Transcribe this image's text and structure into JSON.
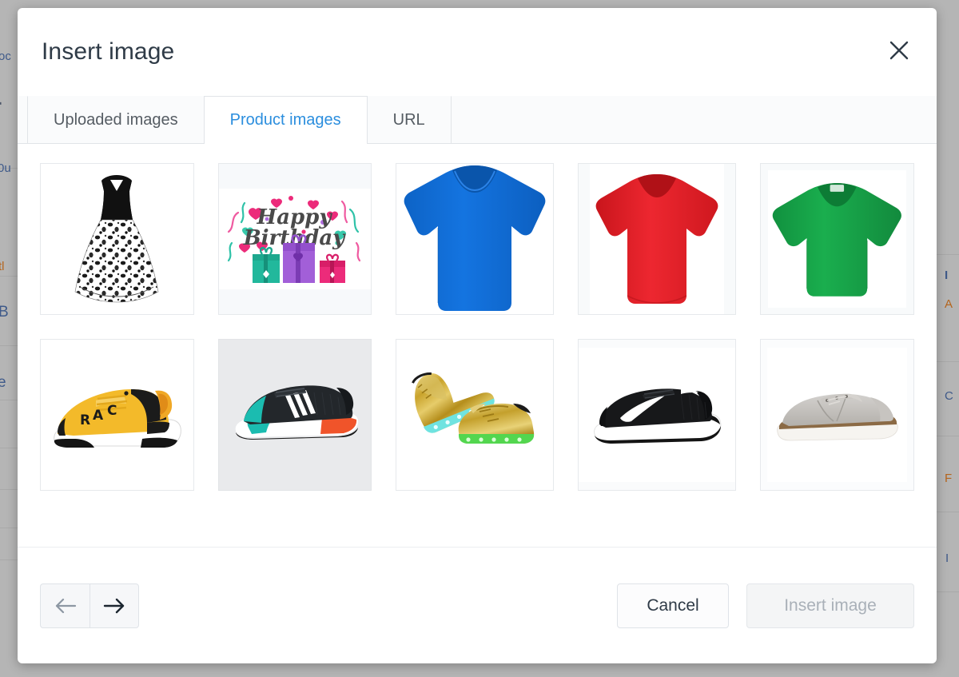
{
  "modal": {
    "title": "Insert image",
    "close_icon": "close-icon",
    "tabs": [
      {
        "label": "Uploaded images",
        "active": false
      },
      {
        "label": "Product images",
        "active": true
      },
      {
        "label": "URL",
        "active": false
      }
    ],
    "active_tab": "Product images",
    "accent_color": "#2b8ede"
  },
  "gallery": {
    "columns": 5,
    "items": [
      {
        "name": "black-white-floral-dress",
        "type": "dress",
        "background": "#ffffff"
      },
      {
        "name": "happy-birthday-card",
        "type": "greeting-card",
        "background": "#f7f9fb"
      },
      {
        "name": "blue-t-shirt",
        "type": "tshirt",
        "color": "#1070d6",
        "background": "#ffffff"
      },
      {
        "name": "red-t-shirt",
        "type": "tshirt",
        "color": "#e4232b",
        "background": "#f8fafb"
      },
      {
        "name": "green-t-shirt",
        "type": "tshirt",
        "color": "#17a84a",
        "background": "#f8fafb"
      },
      {
        "name": "yellow-sneaker",
        "type": "sneaker",
        "color": "#f2b728",
        "background": "#ffffff"
      },
      {
        "name": "black-running-shoe",
        "type": "runner",
        "color": "#222629",
        "background": "#e9eaec"
      },
      {
        "name": "gold-led-sneakers",
        "type": "led-sneakers",
        "color": "#d4a62a",
        "background": "#ffffff"
      },
      {
        "name": "black-nike-sneaker",
        "type": "nike",
        "color": "#161616",
        "background": "#fafbfc"
      },
      {
        "name": "gray-oxford-shoe",
        "type": "oxford",
        "color": "#b9b7b4",
        "background": "#fbfcfd"
      }
    ]
  },
  "footer": {
    "prev_label": "←",
    "next_label": "→",
    "cancel_label": "Cancel",
    "insert_label": "Insert image",
    "insert_disabled": true
  },
  "background_page": {
    "left_fragments": [
      "oc",
      "▪",
      "0u",
      "tl",
      "B",
      "e"
    ],
    "right_fragments": [
      "I",
      "A",
      "C",
      "F",
      "I"
    ]
  }
}
